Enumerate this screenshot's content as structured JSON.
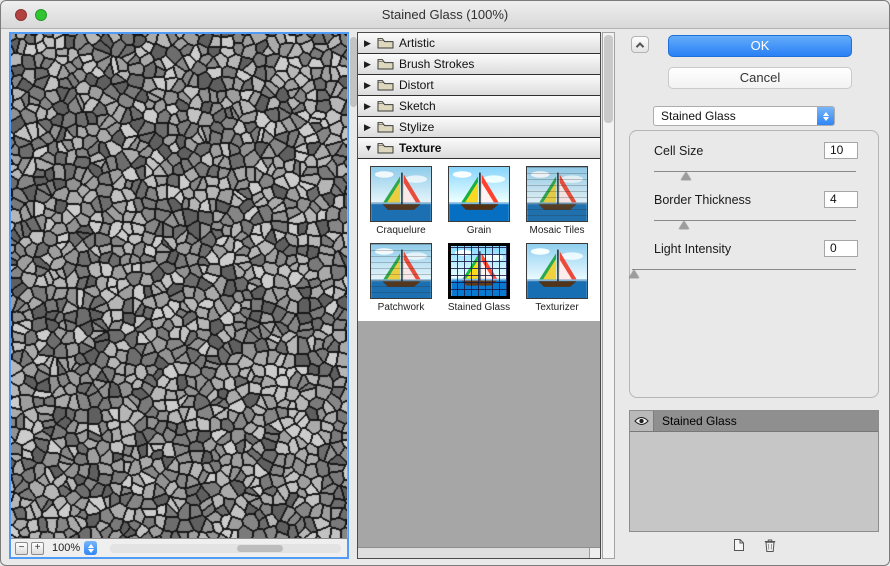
{
  "window": {
    "title": "Stained Glass (100%)"
  },
  "icons": {
    "collapsed": "▶",
    "expanded": "▼"
  },
  "preview": {
    "zoom": "100%",
    "zoom_out": "−",
    "zoom_in": "+"
  },
  "categories": [
    {
      "label": "Artistic",
      "expanded": false
    },
    {
      "label": "Brush Strokes",
      "expanded": false
    },
    {
      "label": "Distort",
      "expanded": false
    },
    {
      "label": "Sketch",
      "expanded": false
    },
    {
      "label": "Stylize",
      "expanded": false
    },
    {
      "label": "Texture",
      "expanded": true
    }
  ],
  "thumbnails": [
    {
      "label": "Craquelure",
      "selected": false
    },
    {
      "label": "Grain",
      "selected": false
    },
    {
      "label": "Mosaic Tiles",
      "selected": false
    },
    {
      "label": "Patchwork",
      "selected": false
    },
    {
      "label": "Stained Glass",
      "selected": true
    },
    {
      "label": "Texturizer",
      "selected": false
    }
  ],
  "controls": {
    "ok_label": "OK",
    "cancel_label": "Cancel",
    "filter_select": "Stained Glass",
    "sliders": [
      {
        "label": "Cell Size",
        "value": "10",
        "thumb_style": "left:16%"
      },
      {
        "label": "Border Thickness",
        "value": "4",
        "thumb_style": "left:15%"
      },
      {
        "label": "Light Intensity",
        "value": "0",
        "thumb_style": "left:1%"
      }
    ]
  },
  "layers": {
    "items": [
      {
        "label": "Stained Glass",
        "visible": true
      }
    ]
  },
  "colors": {
    "accent": "#2f86f6",
    "focus_ring": "#4f9bf5",
    "border_dark": "#1a1a1a"
  }
}
